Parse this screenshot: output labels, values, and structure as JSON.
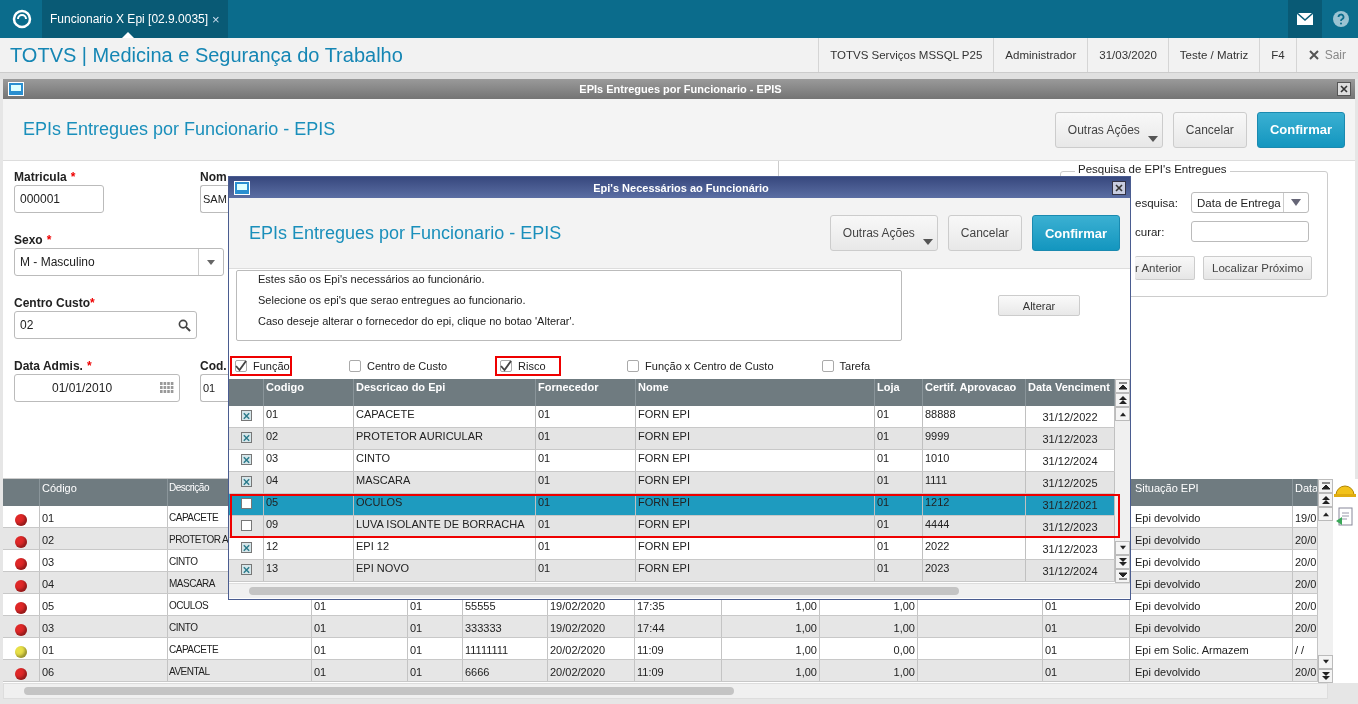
{
  "top_bar": {
    "tab": {
      "label": "Funcionario X Epi [02.9.0035]",
      "close": "×"
    }
  },
  "header": {
    "title": "TOTVS | Medicina e Segurança do Trabalho",
    "status_items": [
      "TOTVS Serviços MSSQL P25",
      "Administrador",
      "31/03/2020",
      "Teste / Matriz",
      "F4"
    ],
    "exit_label": "Sair"
  },
  "window": {
    "title": "EPIs Entregues por Funcionario - EPIS",
    "heading": "EPIs Entregues por Funcionario - EPIS",
    "buttons": [
      {
        "label": "Outras Ações",
        "kind": "menu"
      },
      {
        "label": "Cancelar",
        "kind": "plain"
      },
      {
        "label": "Confirmar",
        "kind": "primary"
      }
    ],
    "fields": [
      {
        "label": "Matricula",
        "required_mark": "*",
        "value": "000001",
        "kind": "text"
      },
      {
        "label": "Nom",
        "value": "SAM",
        "kind": "text"
      },
      {
        "label": "Sexo",
        "required_mark": "*",
        "value": "M - Masculino",
        "kind": "select"
      },
      {
        "label": "Centro Custo",
        "required_mark": "*",
        "value": "02",
        "kind": "lookup"
      },
      {
        "label": "Data Admis.",
        "required_mark": "*",
        "value": "01/01/2010",
        "kind": "date"
      },
      {
        "label": "Cod.",
        "value": "01",
        "kind": "text"
      }
    ],
    "search_group": {
      "legend": "Pesquisa de EPI's Entregues",
      "search_label": "esquisa:",
      "search_value": "Data de Entrega",
      "find_label": "curar:",
      "buttons": [
        "r Anterior",
        "Localizar Próximo"
      ]
    },
    "grid": {
      "columns": [
        "Código",
        "Descrição",
        "Situação EPI",
        "Data"
      ],
      "rows": [
        {
          "color": "#e02828",
          "codigo": "01",
          "descricao": "CAPACETE",
          "situacao": "Epi devolvido",
          "data": "19/0"
        },
        {
          "color": "#e02828",
          "codigo": "02",
          "descricao": "PROTETOR A",
          "situacao": "Epi devolvido",
          "data": "20/0"
        },
        {
          "color": "#e02828",
          "codigo": "03",
          "descricao": "CINTO",
          "situacao": "Epi devolvido",
          "data": "20/0"
        },
        {
          "color": "#e02828",
          "codigo": "04",
          "descricao": "MASCARA",
          "situacao": "Epi devolvido",
          "data": "20/0"
        },
        {
          "color": "#e02828",
          "codigo": "05",
          "descricao": "OCULOS",
          "middle": [
            "01",
            "01",
            "55555",
            "19/02/2020",
            "17:35",
            "1,00",
            "1,00",
            "01"
          ],
          "situacao": "Epi devolvido",
          "data": "20/0"
        },
        {
          "color": "#e02828",
          "codigo": "03",
          "descricao": "CINTO",
          "middle": [
            "01",
            "01",
            "333333",
            "19/02/2020",
            "17:44",
            "1,00",
            "1,00",
            "01"
          ],
          "situacao": "Epi devolvido",
          "data": "20/0"
        },
        {
          "color": "#e8e048",
          "codigo": "01",
          "descricao": "CAPACETE",
          "middle": [
            "01",
            "01",
            "11111111",
            "20/02/2020",
            "11:09",
            "1,00",
            "0,00",
            "01"
          ],
          "situacao": "Epi em Solic. Armazem",
          "data": "/ /"
        },
        {
          "color": "#e02828",
          "codigo": "06",
          "descricao": "AVENTAL",
          "middle": [
            "01",
            "01",
            "6666",
            "20/02/2020",
            "11:09",
            "1,00",
            "1,00",
            "01"
          ],
          "situacao": "Epi devolvido",
          "data": "20/0"
        }
      ]
    }
  },
  "dialog": {
    "title": "Epi's Necessários ao Funcionário",
    "heading": "EPIs Entregues por Funcionario - EPIS",
    "buttons": [
      {
        "label": "Outras Ações",
        "kind": "menu"
      },
      {
        "label": "Cancelar",
        "kind": "plain"
      },
      {
        "label": "Confirmar",
        "kind": "primary"
      }
    ],
    "info_lines": [
      "Estes são os Epi's necessários ao funcionário.",
      "Selecione os epi's que serao entregues ao funcionario.",
      "Caso deseje alterar o fornecedor do epi, clique no botao 'Alterar'."
    ],
    "alter_button": "Alterar",
    "filters": [
      {
        "label": "Função",
        "checked": true,
        "highlighted": true
      },
      {
        "label": "Centro de Custo",
        "checked": false,
        "highlighted": false
      },
      {
        "label": "Risco",
        "checked": true,
        "highlighted": true
      },
      {
        "label": "Função x Centro de Custo",
        "checked": false,
        "highlighted": false
      },
      {
        "label": "Tarefa",
        "checked": false,
        "highlighted": false
      }
    ],
    "columns": [
      "Codigo",
      "Descricao do Epi",
      "Fornecedor",
      "Nome",
      "Loja",
      "Certif. Aprovacao",
      "Data Venciment"
    ],
    "rows": [
      {
        "checked": true,
        "selected": false,
        "highlighted": false,
        "cells": [
          "01",
          "CAPACETE",
          "01",
          "FORN EPI",
          "01",
          "88888",
          "31/12/2022"
        ]
      },
      {
        "checked": true,
        "selected": false,
        "highlighted": false,
        "cells": [
          "02",
          "PROTETOR AURICULAR",
          "01",
          "FORN EPI",
          "01",
          "9999",
          "31/12/2023"
        ]
      },
      {
        "checked": true,
        "selected": false,
        "highlighted": false,
        "cells": [
          "03",
          "CINTO",
          "01",
          "FORN EPI",
          "01",
          "1010",
          "31/12/2024"
        ]
      },
      {
        "checked": true,
        "selected": false,
        "highlighted": false,
        "cells": [
          "04",
          "MASCARA",
          "01",
          "FORN EPI",
          "01",
          "1111",
          "31/12/2025"
        ]
      },
      {
        "checked": false,
        "selected": true,
        "highlighted": true,
        "cells": [
          "05",
          "OCULOS",
          "01",
          "FORN EPI",
          "01",
          "1212",
          "31/12/2021"
        ]
      },
      {
        "checked": false,
        "selected": false,
        "highlighted": true,
        "cells": [
          "09",
          "LUVA ISOLANTE DE BORRACHA",
          "01",
          "FORN EPI",
          "01",
          "4444",
          "31/12/2023"
        ]
      },
      {
        "checked": true,
        "selected": false,
        "highlighted": false,
        "cells": [
          "12",
          "EPI 12",
          "01",
          "FORN EPI",
          "01",
          "2022",
          "31/12/2023"
        ]
      },
      {
        "checked": true,
        "selected": false,
        "highlighted": false,
        "cells": [
          "13",
          "EPI NOVO",
          "01",
          "FORN EPI",
          "01",
          "2023",
          "31/12/2024"
        ]
      }
    ]
  }
}
